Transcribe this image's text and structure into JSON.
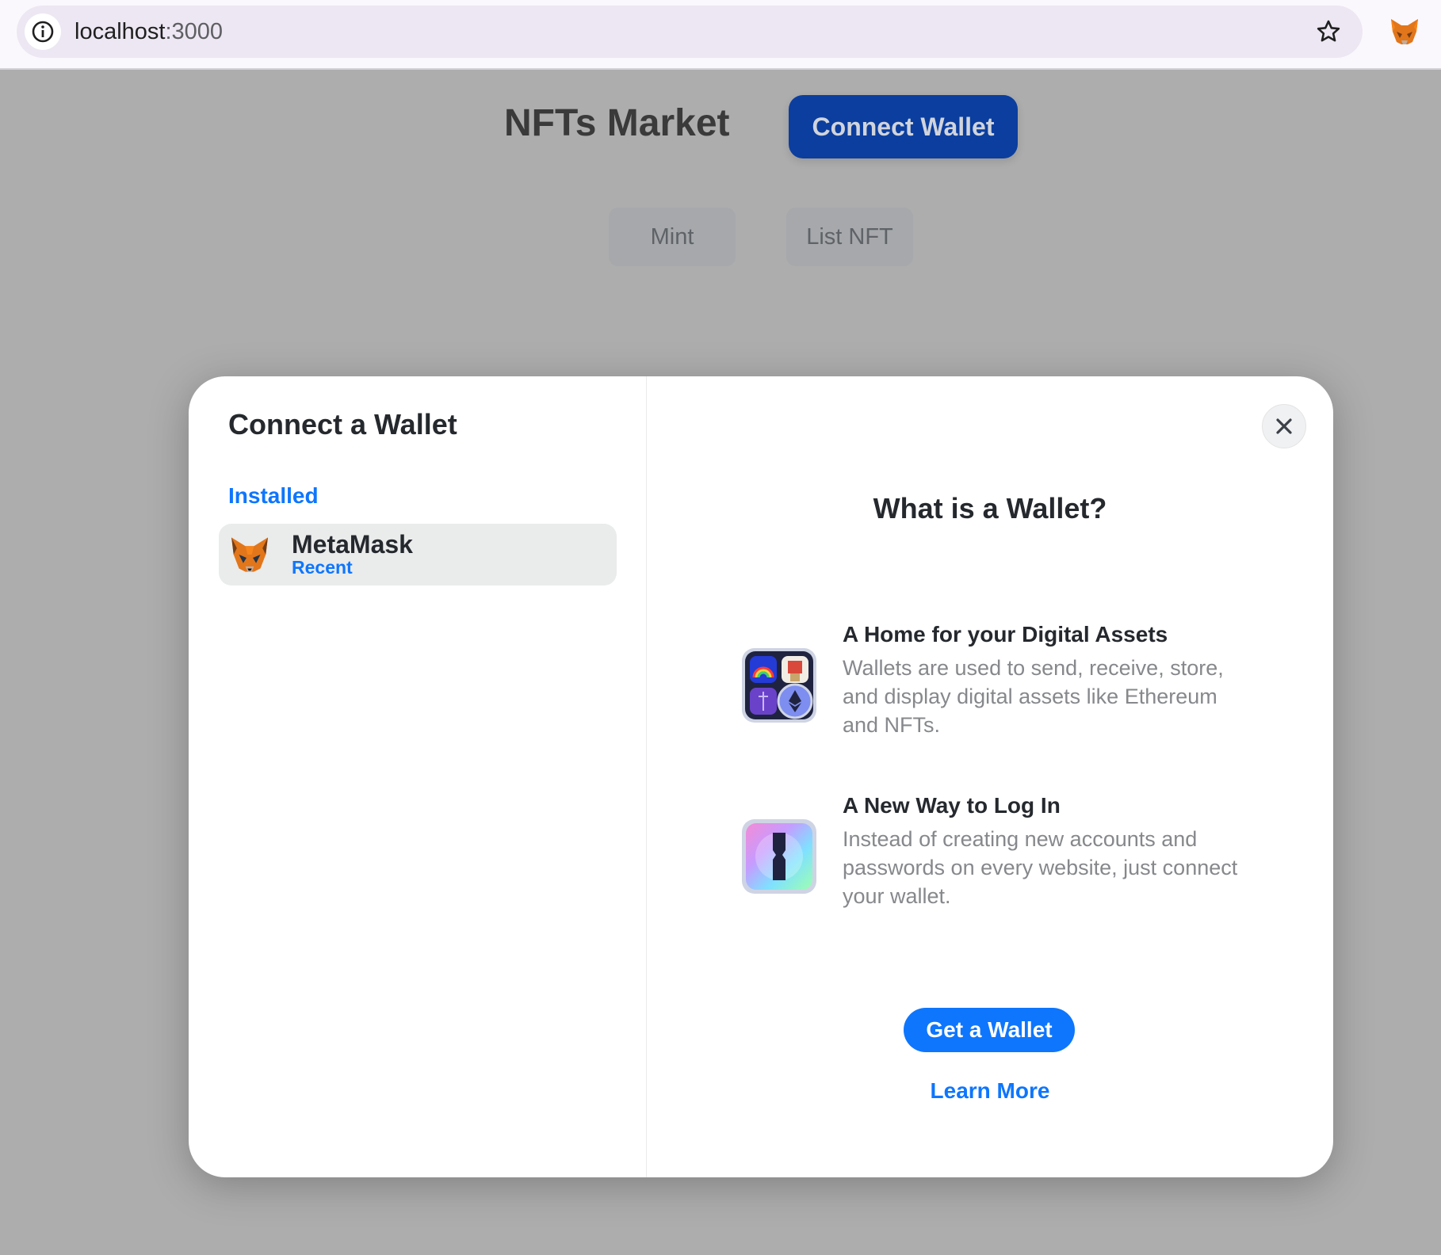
{
  "browser": {
    "url_host": "localhost",
    "url_port": ":3000"
  },
  "page": {
    "title": "NFTs Market",
    "connect_button": "Connect Wallet",
    "mint_button": "Mint",
    "list_button": "List NFT"
  },
  "modal": {
    "title": "Connect a Wallet",
    "installed_label": "Installed",
    "wallets": [
      {
        "name": "MetaMask",
        "subtitle": "Recent",
        "icon": "metamask-fox-icon"
      }
    ],
    "info_title": "What is a Wallet?",
    "features": [
      {
        "title": "A Home for your Digital Assets",
        "description": "Wallets are used to send, receive, store, and display digital assets like Ethereum and NFTs.",
        "icon": "digital-assets-icon"
      },
      {
        "title": "A New Way to Log In",
        "description": "Instead of creating new accounts and passwords on every website, just connect your wallet.",
        "icon": "keyhole-login-icon"
      }
    ],
    "get_wallet_button": "Get a Wallet",
    "learn_more_link": "Learn More"
  },
  "colors": {
    "accent": "#0e76fd",
    "overlay": "#adadad",
    "connect_button_bg": "#0b3e9e"
  }
}
